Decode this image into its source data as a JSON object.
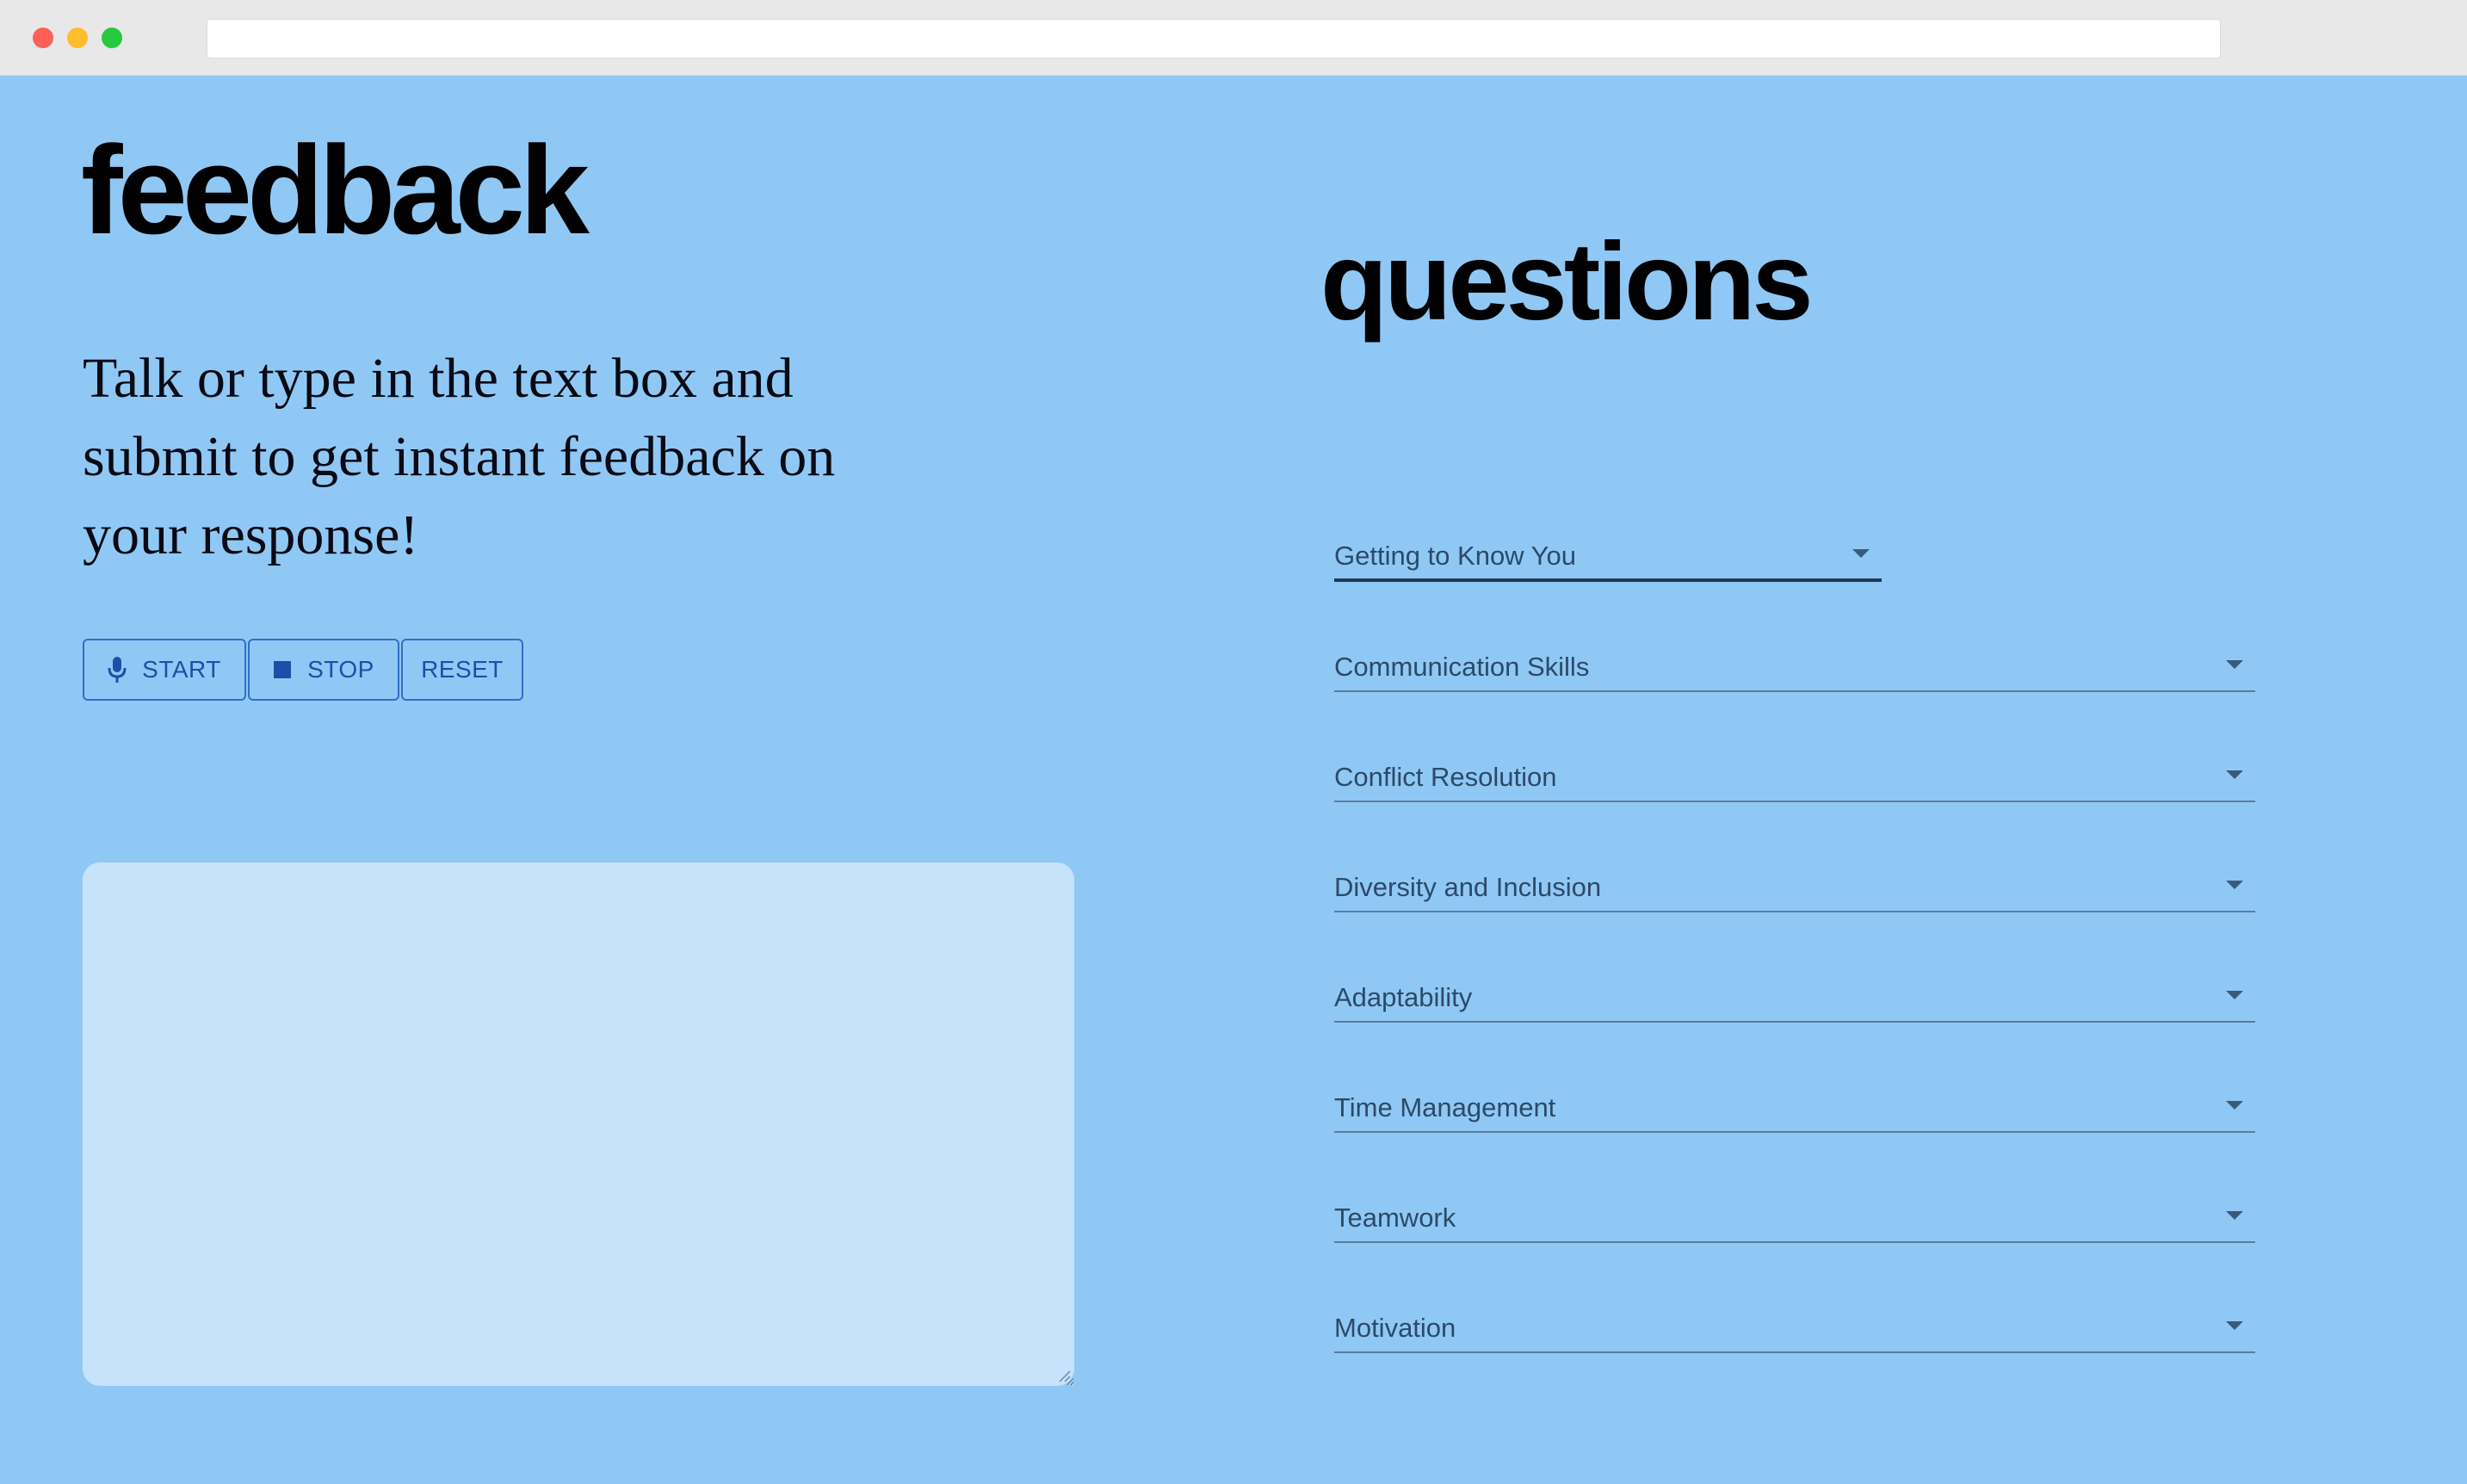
{
  "left": {
    "title": "feedback",
    "intro": "Talk or type in the text box and submit to get instant feedback on your response!",
    "buttons": {
      "start": "START",
      "stop": "STOP",
      "reset": "RESET"
    },
    "response": {
      "value": "",
      "placeholder": ""
    }
  },
  "right": {
    "title": "questions",
    "categories": [
      "Getting to Know You",
      "Communication Skills",
      "Conflict Resolution",
      "Diversity and Inclusion",
      "Adaptability",
      "Time Management",
      "Teamwork",
      "Motivation"
    ]
  },
  "colors": {
    "page_background": "#90c8f5",
    "textbox_background": "#c7e2fb",
    "button_accent": "#1c4fa8"
  },
  "icons": {
    "start": "microphone-icon",
    "stop": "stop-square-icon",
    "select": "caret-down-icon"
  }
}
